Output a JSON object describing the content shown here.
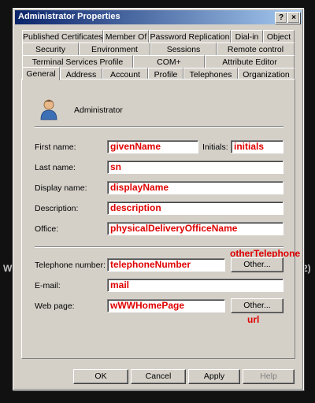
{
  "background_fragments": {
    "left": "W",
    "right": "2)"
  },
  "window": {
    "title": "Administrator Properties"
  },
  "title_buttons": {
    "help": "?",
    "close": "×"
  },
  "tabs": {
    "row1": [
      "Published Certificates",
      "Member Of",
      "Password Replication",
      "Dial-in",
      "Object"
    ],
    "row2": [
      "Security",
      "Environment",
      "Sessions",
      "Remote control"
    ],
    "row3": [
      "Terminal Services Profile",
      "COM+",
      "Attribute Editor"
    ],
    "row4": [
      "General",
      "Address",
      "Account",
      "Profile",
      "Telephones",
      "Organization"
    ],
    "active": "General"
  },
  "general": {
    "account_name": "Administrator",
    "fields": {
      "first_name": {
        "label": "First name:",
        "value": "givenName"
      },
      "initials": {
        "label": "Initials:",
        "value": "initials"
      },
      "last_name": {
        "label": "Last name:",
        "value": "sn"
      },
      "display_name": {
        "label": "Display name:",
        "value": "displayName"
      },
      "description": {
        "label": "Description:",
        "value": "description"
      },
      "office": {
        "label": "Office:",
        "value": "physicalDeliveryOfficeName"
      },
      "telephone": {
        "label": "Telephone number:",
        "value": "telephoneNumber"
      },
      "email": {
        "label": "E-mail:",
        "value": "mail"
      },
      "web_page": {
        "label": "Web page:",
        "value": "wWWHomePage"
      }
    },
    "other_button_label": "Other...",
    "annotations": {
      "other_telephone": "otherTelephone",
      "url": "url"
    }
  },
  "buttons": {
    "ok": "OK",
    "cancel": "Cancel",
    "apply": "Apply",
    "help": "Help"
  },
  "colors": {
    "attribute_text": "#e00000",
    "title_bar": "#0a246a",
    "dialog_face": "#d4d0c8"
  }
}
